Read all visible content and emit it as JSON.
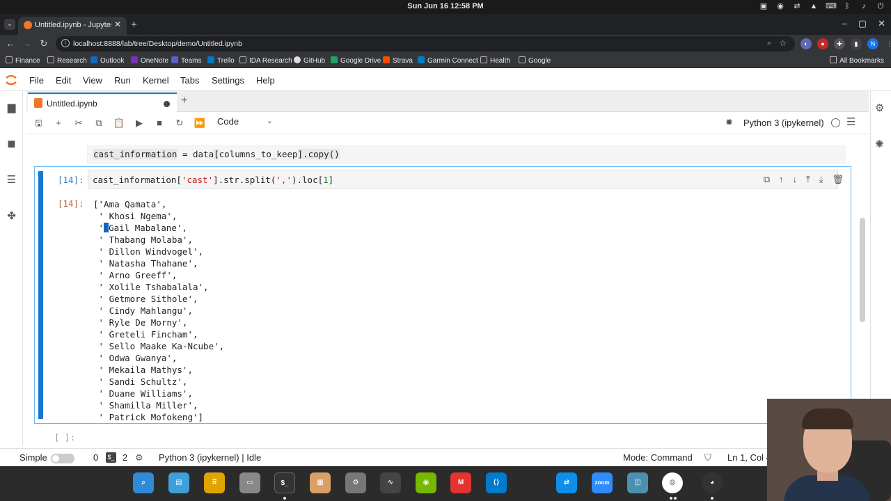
{
  "os": {
    "clock": "Sun Jun 16  12:58 PM"
  },
  "browser": {
    "tab_title": "Untitled.ipynb - JupyterLab",
    "url": "localhost:8888/lab/tree/Desktop/demo/Untitled.ipynb",
    "profile_initial": "N",
    "bookmarks": [
      "Finance",
      "Research",
      "Outlook",
      "OneNote",
      "Teams",
      "Trello",
      "IDA Research",
      "GitHub",
      "Google Drive",
      "Strava",
      "Garmin Connect",
      "Health",
      "Google"
    ],
    "all_bookmarks": "All Bookmarks"
  },
  "jupyter": {
    "menu": [
      "File",
      "Edit",
      "View",
      "Run",
      "Kernel",
      "Tabs",
      "Settings",
      "Help"
    ],
    "doc_tab": "Untitled.ipynb",
    "cell_type": "Code",
    "kernel": "Python 3 (ipykernel)",
    "prev_cell": {
      "var": "cast_information",
      "op": " = ",
      "obj": "data",
      "idx": "columns_to_keep",
      "rest": "].copy()"
    },
    "active_cell": {
      "in_prompt": "[14]:",
      "out_prompt": "[14]:",
      "code_a": "cast_information[",
      "code_str1": "'cast'",
      "code_b": "].str.split(",
      "code_str2": "','",
      "code_c": ").loc[",
      "code_num": "1",
      "code_d": "]",
      "output_first": "['Ama Qamata',",
      "output_cursor_line_prefix": " '",
      "output_cursor_line_rest": "Gail Mabalane',",
      "output_before": [
        " ' Khosi Ngema',"
      ],
      "output_after": [
        " ' Thabang Molaba',",
        " ' Dillon Windvogel',",
        " ' Natasha Thahane',",
        " ' Arno Greeff',",
        " ' Xolile Tshabalala',",
        " ' Getmore Sithole',",
        " ' Cindy Mahlangu',",
        " ' Ryle De Morny',",
        " ' Greteli Fincham',",
        " ' Sello Maake Ka-Ncube',",
        " ' Odwa Gwanya',",
        " ' Mekaila Mathys',",
        " ' Sandi Schultz',",
        " ' Duane Williams',",
        " ' Shamilla Miller',",
        " ' Patrick Mofokeng']"
      ]
    },
    "next_prompt": "[ ]:",
    "status": {
      "mode_label": "Simple",
      "count_a": "0",
      "count_b": "2",
      "kernel_status": "Python 3 (ipykernel) | Idle",
      "mode": "Mode: Command",
      "position": "Ln 1, Col 4"
    }
  },
  "colors": {
    "accent": "#1976d2",
    "jupyter_orange": "#f37626",
    "out_prompt": "#bf5b3d",
    "in_prompt": "#307fc1"
  }
}
